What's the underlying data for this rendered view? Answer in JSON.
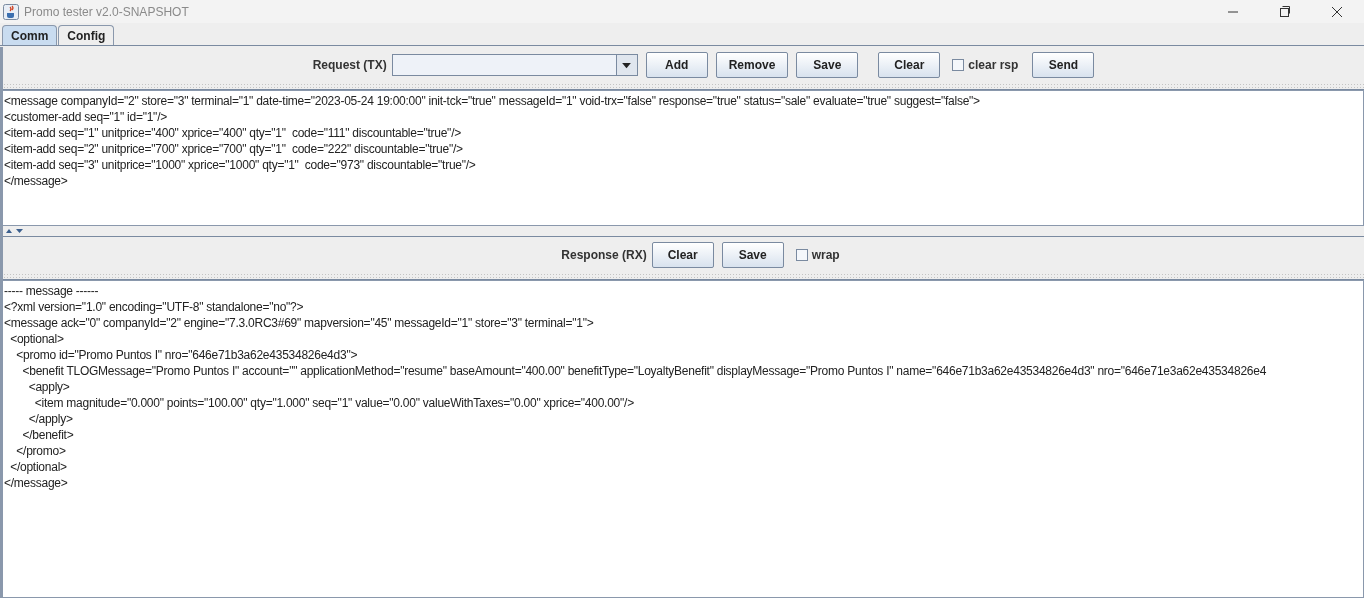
{
  "window": {
    "title": "Promo tester v2.0-SNAPSHOT"
  },
  "tabs": [
    {
      "label": "Comm",
      "selected": true
    },
    {
      "label": "Config",
      "selected": false
    }
  ],
  "request": {
    "label": "Request (TX)",
    "toolbar": [
      {
        "kind": "button",
        "label": "Add"
      },
      {
        "kind": "button",
        "label": "Remove"
      },
      {
        "kind": "button",
        "label": "Save"
      },
      {
        "kind": "button",
        "label": "Clear"
      },
      {
        "kind": "checkbox",
        "label": "clear rsp",
        "checked": false
      },
      {
        "kind": "button",
        "label": "Send"
      }
    ],
    "lines": [
      "<message companyId=\"2\" store=\"3\" terminal=\"1\" date-time=\"2023-05-24 19:00:00\" init-tck=\"true\" messageId=\"1\" void-trx=\"false\" response=\"true\" status=\"sale\" evaluate=\"true\" suggest=\"false\">",
      "<customer-add seq=\"1\" id=\"1\"/>",
      "<item-add seq=\"1\" unitprice=\"400\" xprice=\"400\" qty=\"1\"  code=\"111\" discountable=\"true\"/>",
      "<item-add seq=\"2\" unitprice=\"700\" xprice=\"700\" qty=\"1\"  code=\"222\" discountable=\"true\"/>",
      "<item-add seq=\"3\" unitprice=\"1000\" xprice=\"1000\" qty=\"1\"  code=\"973\" discountable=\"true\"/>",
      "</message>"
    ]
  },
  "response": {
    "label": "Response (RX)",
    "toolbar": [
      {
        "kind": "button",
        "label": "Clear"
      },
      {
        "kind": "button",
        "label": "Save"
      },
      {
        "kind": "checkbox",
        "label": "wrap",
        "checked": false
      }
    ],
    "lines": [
      "----- message ------",
      "<?xml version=\"1.0\" encoding=\"UTF-8\" standalone=\"no\"?>",
      "<message ack=\"0\" companyId=\"2\" engine=\"7.3.0RC3#69\" mapversion=\"45\" messageId=\"1\" store=\"3\" terminal=\"1\">",
      "  <optional>",
      "    <promo id=\"Promo Puntos I\" nro=\"646e71b3a62e43534826e4d3\">",
      "      <benefit TLOGMessage=\"Promo Puntos I\" account=\"\" applicationMethod=\"resume\" baseAmount=\"400.00\" benefitType=\"LoyaltyBenefit\" displayMessage=\"Promo Puntos I\" name=\"646e71b3a62e43534826e4d3\" nro=\"646e71e3a62e43534826e4",
      "        <apply>",
      "          <item magnitude=\"0.000\" points=\"100.00\" qty=\"1.000\" seq=\"1\" value=\"0.00\" valueWithTaxes=\"0.00\" xprice=\"400.00\"/>",
      "        </apply>",
      "      </benefit>",
      "    </promo>",
      "  </optional>",
      "</message>"
    ]
  }
}
